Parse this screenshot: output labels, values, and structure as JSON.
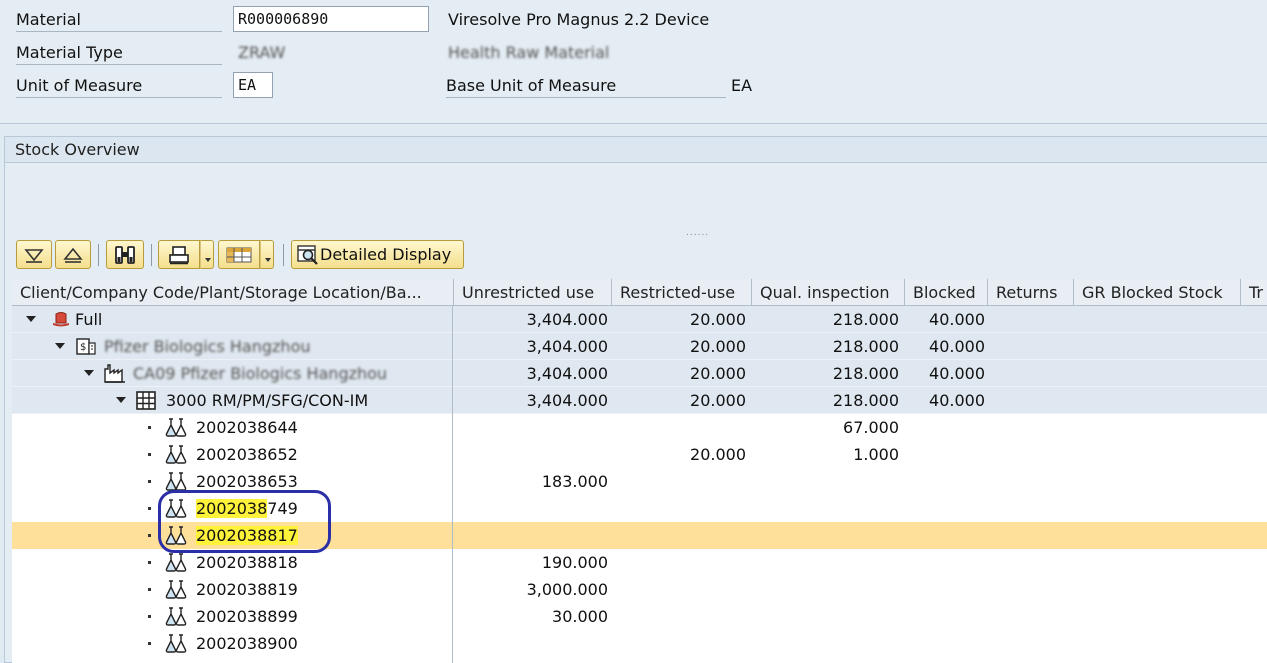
{
  "header": {
    "material_label": "Material",
    "material_value": "R000006890",
    "material_desc": "Viresolve Pro Magnus 2.2 Device",
    "material_type_label": "Material Type",
    "material_type_value": "ZRAW",
    "material_type_desc": "Health Raw Material",
    "uom_label": "Unit of Measure",
    "uom_value": "EA",
    "base_uom_label": "Base Unit of Measure",
    "base_uom_value": "EA"
  },
  "panel": {
    "title": "Stock Overview"
  },
  "toolbar": {
    "expand_icon": "expand-all-icon",
    "collapse_icon": "collapse-all-icon",
    "find_icon": "binoculars-icon",
    "print_icon": "print-icon",
    "layout_icon": "layout-grid-icon",
    "detailed_display_label": "Detailed Display"
  },
  "table": {
    "columns": [
      "Client/Company Code/Plant/Storage Location/Ba...",
      "Unrestricted use",
      "Restricted-use",
      "Qual. inspection",
      "Blocked",
      "Returns",
      "GR Blocked Stock",
      "Tr"
    ],
    "rows": [
      {
        "label": "Full",
        "unrestricted": "3,404.000",
        "restricted": "20.000",
        "qual": "218.000",
        "blocked": "40.000"
      },
      {
        "label": "Pfizer Biologics Hangzhou",
        "unrestricted": "3,404.000",
        "restricted": "20.000",
        "qual": "218.000",
        "blocked": "40.000"
      },
      {
        "label": "CA09 Pfizer Biologics Hangzhou",
        "unrestricted": "3,404.000",
        "restricted": "20.000",
        "qual": "218.000",
        "blocked": "40.000"
      },
      {
        "label": "3000 RM/PM/SFG/CON-IM",
        "unrestricted": "3,404.000",
        "restricted": "20.000",
        "qual": "218.000",
        "blocked": "40.000"
      },
      {
        "label": "2002038644",
        "unrestricted": "",
        "restricted": "",
        "qual": "67.000",
        "blocked": ""
      },
      {
        "label": "2002038652",
        "unrestricted": "",
        "restricted": "20.000",
        "qual": "1.000",
        "blocked": ""
      },
      {
        "label": "2002038653",
        "unrestricted": "183.000",
        "restricted": "",
        "qual": "",
        "blocked": ""
      },
      {
        "label_hl": "2002038",
        "label_rest": "749",
        "unrestricted": "",
        "restricted": "",
        "qual": "",
        "blocked": ""
      },
      {
        "label_hl": "2002038817",
        "label_rest": "",
        "unrestricted": "",
        "restricted": "",
        "qual": "",
        "blocked": ""
      },
      {
        "label": "2002038818",
        "unrestricted": "190.000",
        "restricted": "",
        "qual": "",
        "blocked": ""
      },
      {
        "label": "2002038819",
        "unrestricted": "3,000.000",
        "restricted": "",
        "qual": "",
        "blocked": ""
      },
      {
        "label": "2002038899",
        "unrestricted": "30.000",
        "restricted": "",
        "qual": "",
        "blocked": ""
      },
      {
        "label": "2002038900",
        "unrestricted": "",
        "restricted": "",
        "qual": "",
        "blocked": ""
      }
    ]
  }
}
